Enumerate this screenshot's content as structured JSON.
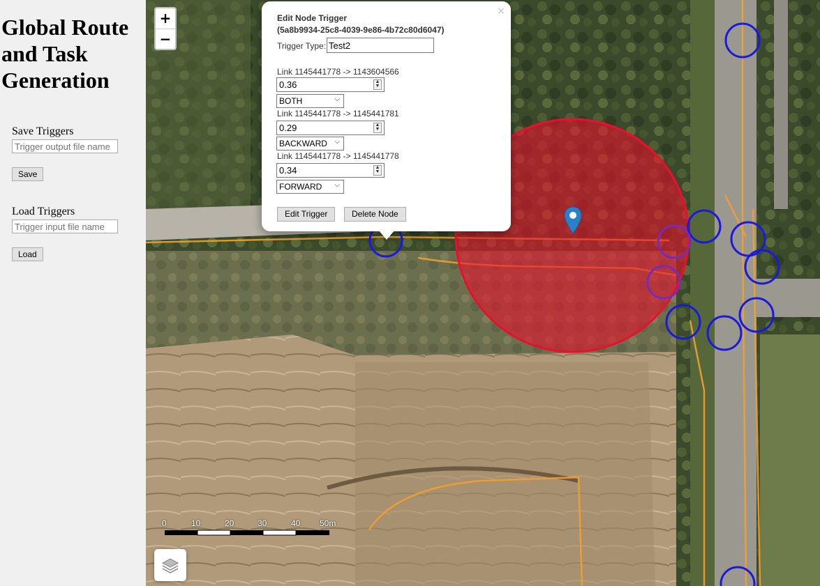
{
  "sidebar": {
    "title": "Global Route and Task Generation",
    "save_section_label": "Save Triggers",
    "save_placeholder": "Trigger output file name",
    "save_button": "Save",
    "load_section_label": "Load Triggers",
    "load_placeholder": "Trigger input file name",
    "load_button": "Load"
  },
  "map": {
    "zoom_in": "+",
    "zoom_out": "−",
    "scale_labels": [
      "0",
      "10",
      "20",
      "30",
      "40",
      "50m"
    ],
    "layers_icon": "layers-icon",
    "marker_icon": "map-marker-icon",
    "trigger_circle_color": "#e8112d",
    "node_circle_color": "#1a1adb",
    "route_color": "#f0a030"
  },
  "popup": {
    "title_line1": "Edit Node Trigger",
    "title_line2": "(5a8b9934-25c8-4039-9e86-4b72c80d6047)",
    "trigger_type_label": "Trigger Type:",
    "trigger_type_value": "Test2",
    "close": "×",
    "links": [
      {
        "label": "Link 1145441778 -> 1143604566",
        "value": "0.36",
        "direction": "BOTH"
      },
      {
        "label": "Link 1145441778 -> 1145441781",
        "value": "0.29",
        "direction": "BACKWARD"
      },
      {
        "label": "Link 1145441778 -> 1145441778",
        "value": "0.34",
        "direction": "FORWARD"
      }
    ],
    "edit_button": "Edit Trigger",
    "delete_button": "Delete Node"
  }
}
